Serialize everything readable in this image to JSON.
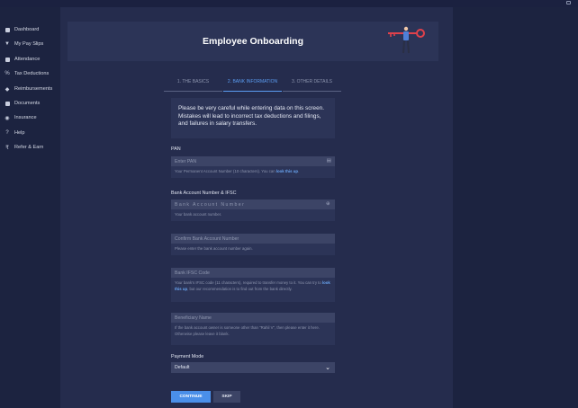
{
  "sidebar": {
    "items": [
      {
        "label": "Dashboard",
        "icon": "briefcase-icon"
      },
      {
        "label": "My Pay Slips",
        "icon": "filter-icon"
      },
      {
        "label": "Attendance",
        "icon": "calendar-icon"
      },
      {
        "label": "Tax Deductions",
        "icon": "percent-icon"
      },
      {
        "label": "Reimbursements",
        "icon": "tag-icon"
      },
      {
        "label": "Documents",
        "icon": "document-icon"
      },
      {
        "label": "Insurance",
        "icon": "shield-icon"
      },
      {
        "label": "Help",
        "icon": "question-icon"
      },
      {
        "label": "Refer & Earn",
        "icon": "rupee-icon"
      }
    ]
  },
  "banner": {
    "title": "Employee Onboarding"
  },
  "steps": [
    {
      "label": "1. THE BASICS"
    },
    {
      "label": "2. BANK INFORMATION"
    },
    {
      "label": "3. OTHER DETAILS"
    }
  ],
  "notice": "Please be very careful while entering data on this screen. Mistakes will lead to incorrect tax deductions and filings, and failures in salary transfers.",
  "form": {
    "pan": {
      "label": "PAN",
      "placeholder": "Enter PAN",
      "help_prefix": "Your Permanent Account Number (10 characters). You can ",
      "help_link": "look this up",
      "help_suffix": "."
    },
    "bank_section_label": "Bank Account Number & IFSC",
    "account": {
      "placeholder": "Bank Account Number",
      "help": "Your bank account number."
    },
    "confirm": {
      "placeholder": "Confirm Bank Account Number",
      "help": "Please enter the bank account number again."
    },
    "ifsc": {
      "placeholder": "Bank IFSC Code",
      "help_prefix": "Your bank's IFSC code (11 characters), required to transfer money to it. You can try to ",
      "help_link": "look this up",
      "help_suffix": ", but our recommendation is to find out from the bank directly."
    },
    "beneficiary": {
      "placeholder": "Beneficiary Name",
      "help": "If the bank account owner is someone other than \"Rahil V\", then please enter it here. Otherwise please leave it blank."
    },
    "payment_mode": {
      "label": "Payment Mode",
      "selected": "Default"
    },
    "continue_label": "CONTINUE",
    "skip_label": "SKIP"
  }
}
